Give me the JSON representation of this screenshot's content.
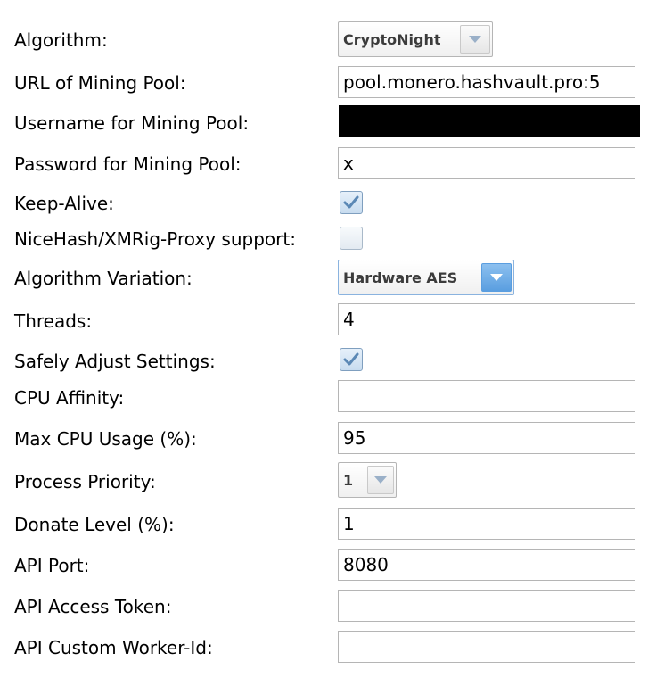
{
  "form": {
    "algorithm": {
      "label": "Algorithm:",
      "value": "CryptoNight"
    },
    "pool_url": {
      "label": "URL of Mining Pool:",
      "value": "pool.monero.hashvault.pro:5"
    },
    "pool_username": {
      "label": "Username for Mining Pool:",
      "value": ""
    },
    "pool_password": {
      "label": "Password for Mining Pool:",
      "value": "x"
    },
    "keep_alive": {
      "label": "Keep-Alive:",
      "checked": true
    },
    "nicehash": {
      "label": "NiceHash/XMRig-Proxy support:",
      "checked": false
    },
    "algorithm_variation": {
      "label": "Algorithm Variation:",
      "value": "Hardware AES"
    },
    "threads": {
      "label": "Threads:",
      "value": "4"
    },
    "safely_adjust": {
      "label": "Safely Adjust Settings:",
      "checked": true
    },
    "cpu_affinity": {
      "label": "CPU Affinity:",
      "value": ""
    },
    "max_cpu_usage": {
      "label": "Max CPU Usage (%):",
      "value": "95"
    },
    "process_priority": {
      "label": "Process Priority:",
      "value": "1"
    },
    "donate_level": {
      "label": "Donate Level (%):",
      "value": "1"
    },
    "api_port": {
      "label": "API Port:",
      "value": "8080"
    },
    "api_access_token": {
      "label": "API Access Token:",
      "value": ""
    },
    "api_worker_id": {
      "label": "API Custom Worker-Id:",
      "value": ""
    }
  },
  "icons": {
    "dropdown": "chevron-down-icon",
    "check": "checkmark-icon"
  },
  "colors": {
    "focused_dropdown_accent": "#5a9ee0",
    "masked_field": "#000000"
  }
}
